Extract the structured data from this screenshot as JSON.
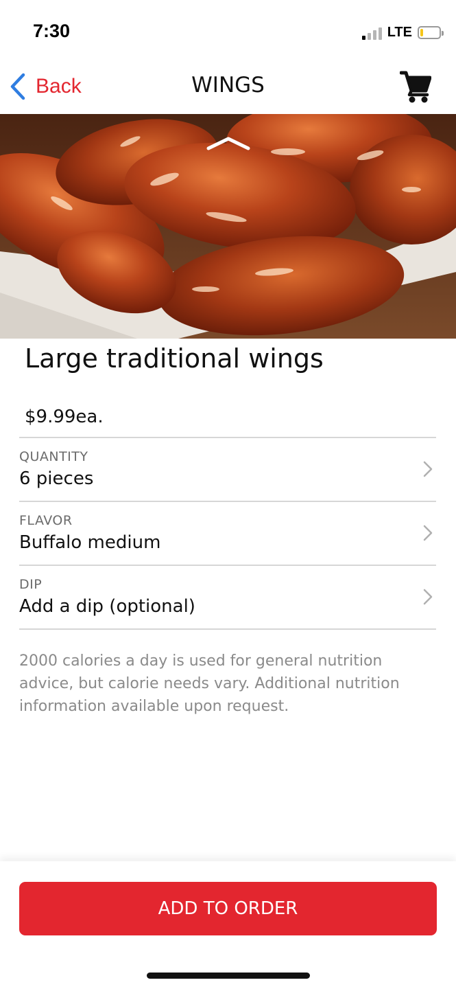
{
  "status_bar": {
    "time": "7:30",
    "network": "LTE",
    "signal_bars_active": 1,
    "signal_bars_total": 4,
    "battery_level": 0.15
  },
  "nav": {
    "back_label": "Back",
    "back_icon": "chevron-left-icon",
    "title": "WINGS",
    "cart_icon": "shopping-cart-icon"
  },
  "hero": {
    "collapse_icon": "chevron-up-icon"
  },
  "product": {
    "title": "Large traditional wings",
    "price": "$9.99ea."
  },
  "options": [
    {
      "label": "QUANTITY",
      "value": "6 pieces"
    },
    {
      "label": "FLAVOR",
      "value": "Buffalo medium"
    },
    {
      "label": "DIP",
      "value": "Add a dip (optional)"
    }
  ],
  "nutrition_notice": "2000 calories a day is used for general nutrition advice, but calorie needs vary. Additional nutrition information available upon request.",
  "cta": {
    "label": "ADD TO ORDER"
  },
  "colors": {
    "accent_red": "#e3262f",
    "back_blue": "#2f7de1",
    "back_text_red": "#e3262f",
    "battery_yellow": "#f5c518",
    "signal_active": "#000000",
    "signal_inactive": "#b5b5b5"
  }
}
